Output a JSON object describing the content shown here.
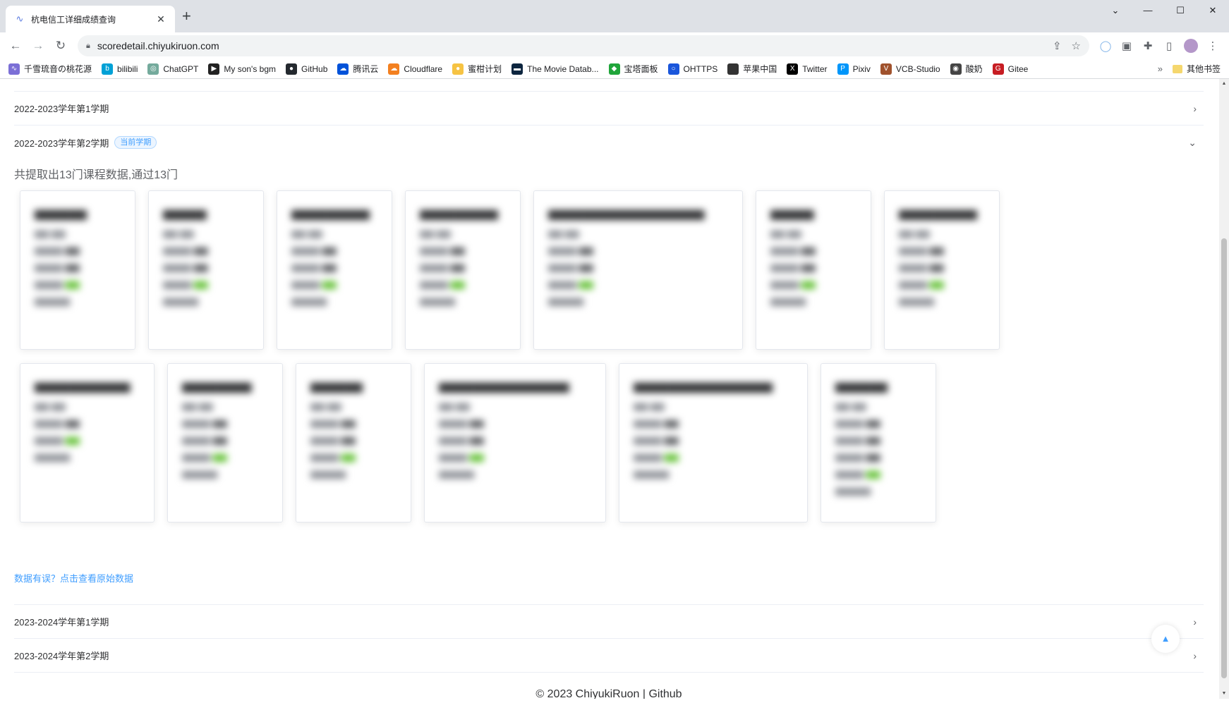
{
  "browser": {
    "tab_title": "杭电信工详细成绩查询",
    "new_tab": "+",
    "window_controls": [
      "⌄",
      "—",
      "☐",
      "✕"
    ],
    "url": "scoredetail.chiyukiruon.com",
    "bookmarks": [
      {
        "label": "千雪琉音の桃花源",
        "color": "#7b6fd6",
        "glyph": "∿"
      },
      {
        "label": "bilibili",
        "color": "#00a1d6",
        "glyph": "b"
      },
      {
        "label": "ChatGPT",
        "color": "#74aa9c",
        "glyph": "◎"
      },
      {
        "label": "My son's bgm",
        "color": "#222222",
        "glyph": "▶"
      },
      {
        "label": "GitHub",
        "color": "#24292f",
        "glyph": "●"
      },
      {
        "label": "腾讯云",
        "color": "#0052d9",
        "glyph": "☁"
      },
      {
        "label": "Cloudflare",
        "color": "#f38020",
        "glyph": "☁"
      },
      {
        "label": "蜜柑计划",
        "color": "#f6c343",
        "glyph": "●"
      },
      {
        "label": "The Movie Datab...",
        "color": "#0d253f",
        "glyph": "▬"
      },
      {
        "label": "宝塔面板",
        "color": "#20a53a",
        "glyph": "◆"
      },
      {
        "label": "OHTTPS",
        "color": "#1a56db",
        "glyph": "○"
      },
      {
        "label": "苹果中国",
        "color": "#333333",
        "glyph": ""
      },
      {
        "label": "Twitter",
        "color": "#000000",
        "glyph": "X"
      },
      {
        "label": "Pixiv",
        "color": "#0096fa",
        "glyph": "P"
      },
      {
        "label": "VCB-Studio",
        "color": "#a0522d",
        "glyph": "V"
      },
      {
        "label": "酸奶",
        "color": "#444444",
        "glyph": "◉"
      },
      {
        "label": "Gitee",
        "color": "#c71d23",
        "glyph": "G"
      }
    ],
    "bookmarks_more": "»",
    "other_bookmarks": "其他书签"
  },
  "semesters": {
    "s1": {
      "label": "2022-2023学年第1学期"
    },
    "s2": {
      "label": "2022-2023学年第2学期",
      "tag": "当前学期"
    },
    "s3": {
      "label": "2023-2024学年第1学期"
    },
    "s4": {
      "label": "2023-2024学年第2学期"
    }
  },
  "summary": "共提取出13门课程数据,通过13门",
  "raw_link": "数据有误？点击查看原始数据",
  "footer": {
    "copyright": "© 2023 ChiyukiRuon | ",
    "github": "Github"
  },
  "backtop_icon": "caret-up-icon",
  "colors": {
    "primary": "#409eff",
    "pass": "#67c23a",
    "border": "#ebeef5"
  }
}
